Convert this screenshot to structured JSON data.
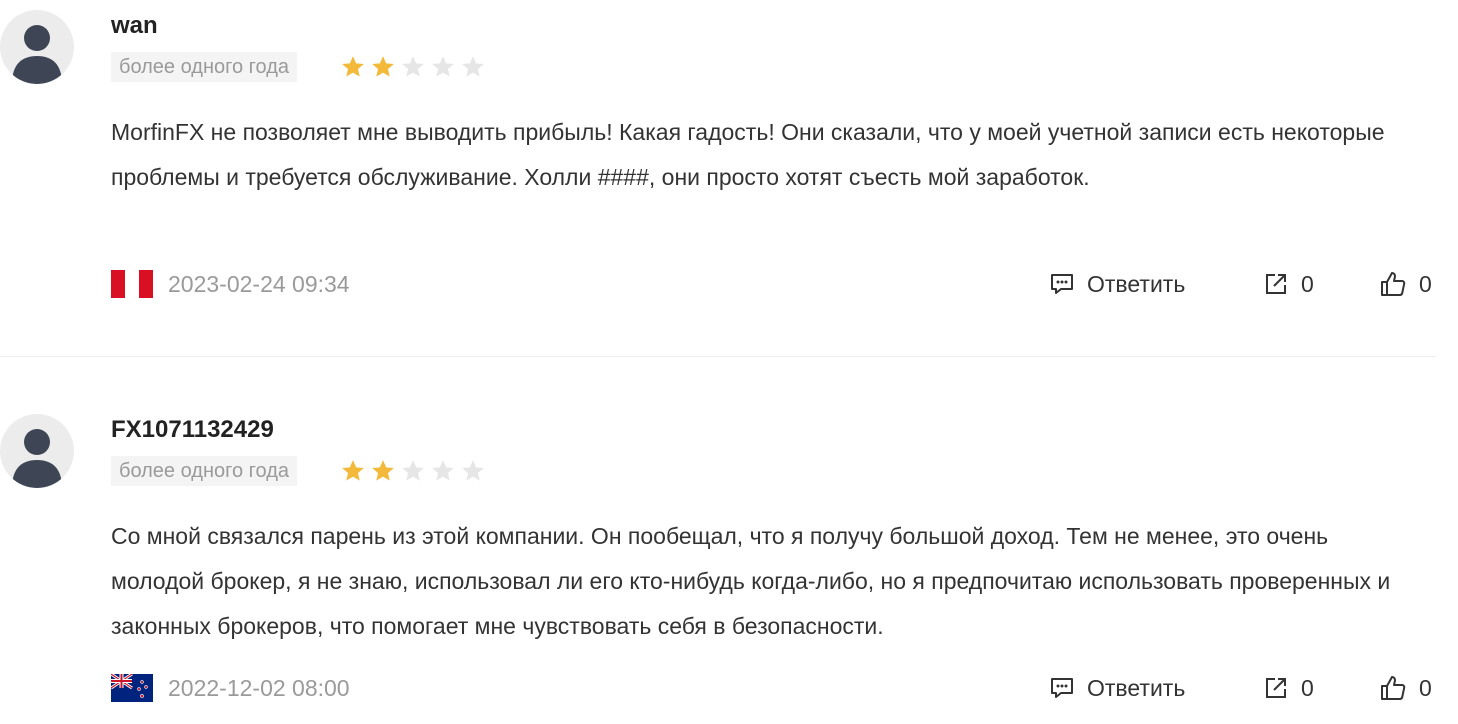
{
  "reviews": [
    {
      "username": "wan",
      "time_badge": "более одного года",
      "rating": 2,
      "rating_max": 5,
      "text": "MorfinFX не позволяет мне выводить прибыль! Какая гадость! Они сказали, что у моей учетной записи есть некоторые проблемы и требуется обслуживание. Холли ####, они просто хотят съесть мой заработок.",
      "country_flag": "peru-flag",
      "date": "2023-02-24 09:34",
      "reply_label": "Ответить",
      "share_count": "0",
      "like_count": "0"
    },
    {
      "username": "FX1071132429",
      "time_badge": "более одного года",
      "rating": 2,
      "rating_max": 5,
      "text": "Со мной связался парень из этой компании. Он пообещал, что я получу большой доход. Тем не менее, это очень молодой брокер, я не знаю, использовал ли его кто-нибудь когда-либо, но я предпочитаю использовать проверенных и законных брокеров, что помогает мне чувствовать себя в безопасности.",
      "country_flag": "new-zealand-flag",
      "date": "2022-12-02 08:00",
      "reply_label": "Ответить",
      "share_count": "0",
      "like_count": "0"
    }
  ],
  "colors": {
    "star_filled": "#f2b93b",
    "star_empty": "#e6e6e6",
    "muted_text": "#9a9a9a",
    "body_text": "#333333",
    "avatar_figure": "#3e4656",
    "avatar_bg": "#ececec"
  }
}
